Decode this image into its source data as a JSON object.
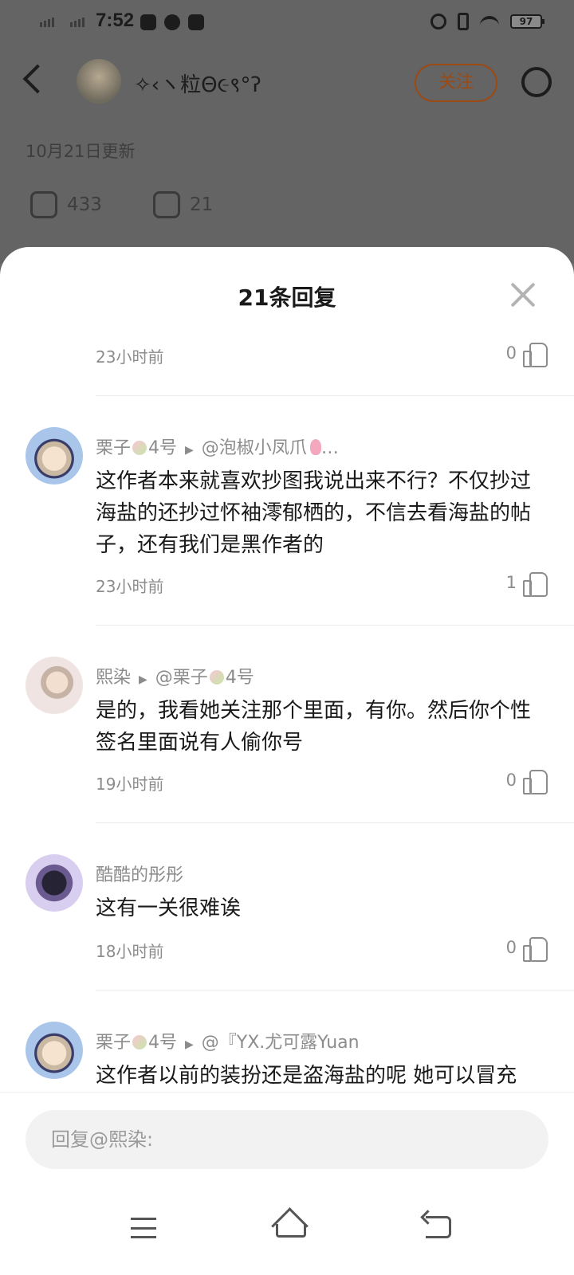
{
  "status_bar": {
    "time": "7:52",
    "battery": "97",
    "icons": [
      "signal-icon",
      "signal-icon",
      "play-store-icon",
      "app-icon",
      "search-app-icon",
      "alarm-icon",
      "vibrate-icon",
      "wifi-icon",
      "battery-icon"
    ]
  },
  "post": {
    "author": "✧‹ヽ粒Θ૯९°ʔ",
    "follow_label": "关注",
    "updated": "10月21日更新",
    "likes": "433",
    "comments": "21"
  },
  "sheet": {
    "title": "21条回复"
  },
  "top_item": {
    "time": "23小时前",
    "likes": "0"
  },
  "comments": [
    {
      "author": "栗子",
      "author_suffix": "4号",
      "reply_to": "@泡椒小凤爪",
      "reply_more": "…",
      "text": "这作者本来就喜欢抄图我说出来不行？不仅抄过海盐的还抄过怀袖澪郁栖的，不信去看海盐的帖子，还有我们是黑作者的",
      "time": "23小时前",
      "likes": "1"
    },
    {
      "author": "熙染",
      "reply_to": "@栗子",
      "reply_suffix": "4号",
      "text": "是的，我看她关注那个里面，有你。然后你个性签名里面说有人偷你号",
      "time": "19小时前",
      "likes": "0"
    },
    {
      "author": "酷酷的彤彤",
      "text": "这有一关很难诶",
      "time": "18小时前",
      "likes": "0"
    },
    {
      "author": "栗子",
      "author_suffix": "4号",
      "reply_to": "@『YX.尤可露Yuan",
      "text": "这作者以前的装扮还是盗海盐的呢 她可以冒充"
    }
  ],
  "input": {
    "placeholder": "回复@熙染:"
  }
}
